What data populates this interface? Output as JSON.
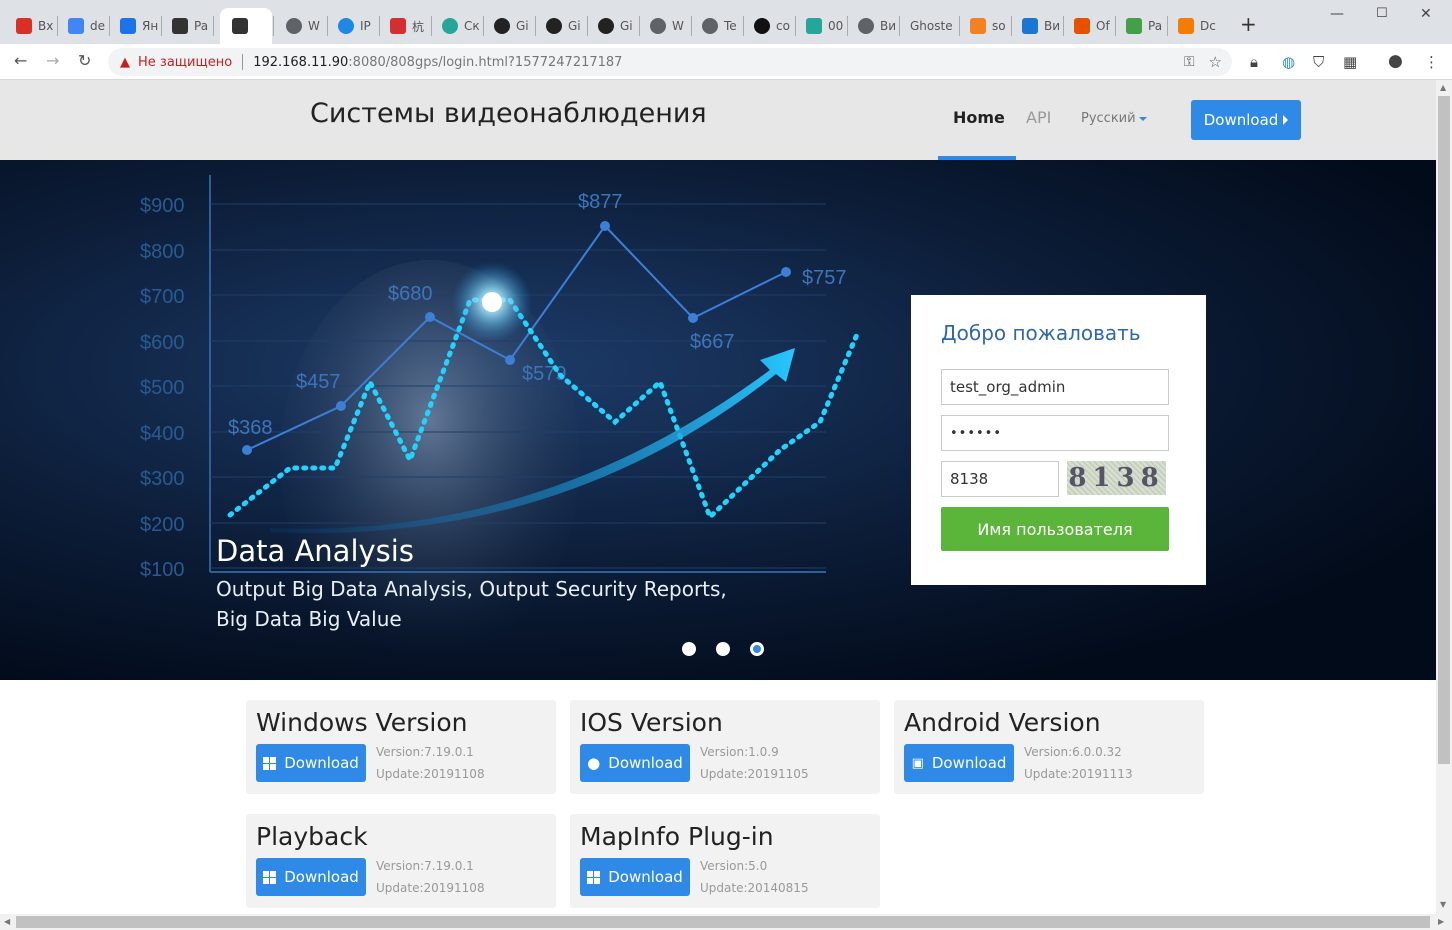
{
  "browser": {
    "tabs": [
      {
        "label": "Вх",
        "icon": "gmail-icon",
        "color": "#d93025"
      },
      {
        "label": "de",
        "icon": "document-icon",
        "color": "#4285f4"
      },
      {
        "label": "Ян",
        "icon": "cloud-icon",
        "color": "#1a73e8"
      },
      {
        "label": "Pa",
        "icon": "page-icon",
        "color": "#333333"
      },
      {
        "label": "",
        "icon": "bug-icon",
        "color": "#333333",
        "active": true
      },
      {
        "label": "W",
        "icon": "globe-icon",
        "color": "#5f6368"
      },
      {
        "label": "IP",
        "icon": "globe-icon",
        "color": "#1e88e5"
      },
      {
        "label": "杭",
        "icon": "xm-icon",
        "color": "#d32f2f"
      },
      {
        "label": "Ск",
        "icon": "globe-icon",
        "color": "#26a69a"
      },
      {
        "label": "Gi",
        "icon": "github-icon",
        "color": "#222222"
      },
      {
        "label": "Gi",
        "icon": "github-icon",
        "color": "#222222"
      },
      {
        "label": "Gi",
        "icon": "github-icon",
        "color": "#222222"
      },
      {
        "label": "W",
        "icon": "globe-icon",
        "color": "#5f6368"
      },
      {
        "label": "Te",
        "icon": "globe-icon",
        "color": "#5f6368"
      },
      {
        "label": "co",
        "icon": "circle-icon",
        "color": "#111111"
      },
      {
        "label": "00",
        "icon": "c-icon",
        "color": "#26a69a"
      },
      {
        "label": "Ви",
        "icon": "globe-icon",
        "color": "#5f6368"
      },
      {
        "label": "Ghoste",
        "icon": "",
        "color": "#ffffff"
      },
      {
        "label": "so",
        "icon": "stack-icon",
        "color": "#f48024"
      },
      {
        "label": "Ви",
        "icon": "h-icon",
        "color": "#1976d2"
      },
      {
        "label": "Of",
        "icon": "star-icon",
        "color": "#e65100"
      },
      {
        "label": "Pa",
        "icon": "y-icon",
        "color": "#43a047"
      },
      {
        "label": "Dc",
        "icon": "diamond-icon",
        "color": "#f57c00"
      }
    ],
    "not_secure": "Не защищено",
    "url_main": "192.168.11.90",
    "url_rest": ":8080/808gps/login.html?1577247217187"
  },
  "header": {
    "brand": "Системы видеонаблюдения",
    "nav_home": "Home",
    "nav_api": "API",
    "nav_lang": "Русский",
    "download": "Download"
  },
  "hero": {
    "title": "Data Analysis",
    "subtitle": "Output Big Data Analysis, Output Security Reports, Big Data Big Value",
    "y_ticks": [
      "$900",
      "$800",
      "$700",
      "$600",
      "$500",
      "$400",
      "$300",
      "$200",
      "$100"
    ],
    "point_labels": [
      "$368",
      "$457",
      "$680",
      "$579",
      "$877",
      "$667",
      "$757"
    ],
    "slides": 3,
    "active_slide": 2
  },
  "login": {
    "title": "Добро пожаловать",
    "username": "test_org_admin",
    "password": "••••••",
    "captcha_input": "8138",
    "captcha_image_text": "8138",
    "submit": "Имя пользователя"
  },
  "downloads": [
    {
      "title": "Windows Version",
      "button": "Download",
      "version": "Version:7.19.0.1",
      "update": "Update:20191108",
      "icon": "windows-icon"
    },
    {
      "title": "IOS Version",
      "button": "Download",
      "version": "Version:1.0.9",
      "update": "Update:20191105",
      "icon": "apple-icon"
    },
    {
      "title": "Android Version",
      "button": "Download",
      "version": "Version:6.0.0.32",
      "update": "Update:20191113",
      "icon": "android-icon"
    },
    {
      "title": "Playback",
      "button": "Download",
      "version": "Version:7.19.0.1",
      "update": "Update:20191108",
      "icon": "windows-icon"
    },
    {
      "title": "MapInfo Plug-in",
      "button": "Download",
      "version": "Version:5.0",
      "update": "Update:20140815",
      "icon": "windows-icon"
    }
  ]
}
